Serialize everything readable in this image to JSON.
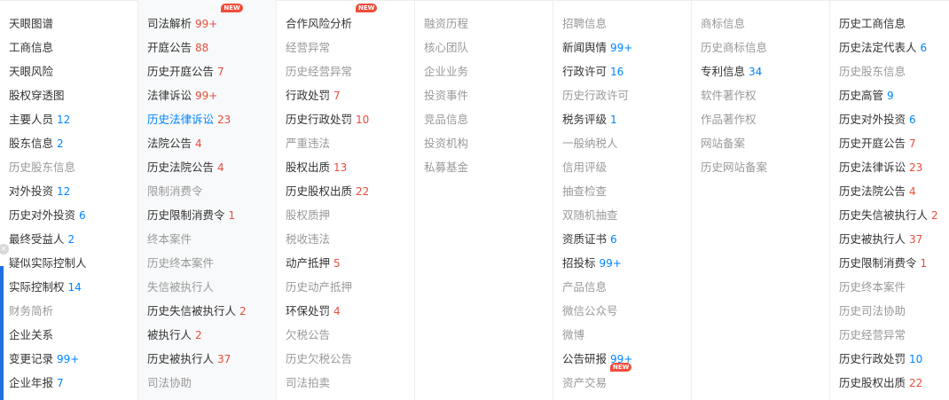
{
  "columns": [
    [
      {
        "label": "天眼图谱",
        "style": "normal"
      },
      {
        "label": "工商信息",
        "style": "normal"
      },
      {
        "label": "天眼风险",
        "style": "normal"
      },
      {
        "label": "股权穿透图",
        "style": "normal"
      },
      {
        "label": "主要人员",
        "style": "normal",
        "count": "12",
        "count_color": "blue"
      },
      {
        "label": "股东信息",
        "style": "normal",
        "count": "2",
        "count_color": "blue"
      },
      {
        "label": "历史股东信息",
        "style": "muted"
      },
      {
        "label": "对外投资",
        "style": "normal",
        "count": "12",
        "count_color": "blue"
      },
      {
        "label": "历史对外投资",
        "style": "normal",
        "count": "6",
        "count_color": "blue"
      },
      {
        "label": "最终受益人",
        "style": "normal",
        "count": "2",
        "count_color": "blue"
      },
      {
        "label": "疑似实际控制人",
        "style": "normal"
      },
      {
        "label": "实际控制权",
        "style": "normal",
        "count": "14",
        "count_color": "blue"
      },
      {
        "label": "财务简析",
        "style": "muted"
      },
      {
        "label": "企业关系",
        "style": "normal"
      },
      {
        "label": "变更记录",
        "style": "normal",
        "count": "99+",
        "count_color": "blue"
      },
      {
        "label": "企业年报",
        "style": "normal",
        "count": "7",
        "count_color": "blue"
      }
    ],
    [
      {
        "label": "司法解析",
        "style": "normal",
        "count": "99+",
        "count_color": "red",
        "badge": "NEW"
      },
      {
        "label": "开庭公告",
        "style": "normal",
        "count": "88",
        "count_color": "red"
      },
      {
        "label": "历史开庭公告",
        "style": "normal",
        "count": "7",
        "count_color": "red"
      },
      {
        "label": "法律诉讼",
        "style": "normal",
        "count": "99+",
        "count_color": "red"
      },
      {
        "label": "历史法律诉讼",
        "style": "link",
        "count": "23",
        "count_color": "red"
      },
      {
        "label": "法院公告",
        "style": "normal",
        "count": "4",
        "count_color": "red"
      },
      {
        "label": "历史法院公告",
        "style": "normal",
        "count": "4",
        "count_color": "red"
      },
      {
        "label": "限制消费令",
        "style": "muted"
      },
      {
        "label": "历史限制消费令",
        "style": "normal",
        "count": "1",
        "count_color": "red"
      },
      {
        "label": "终本案件",
        "style": "muted"
      },
      {
        "label": "历史终本案件",
        "style": "muted"
      },
      {
        "label": "失信被执行人",
        "style": "muted"
      },
      {
        "label": "历史失信被执行人",
        "style": "normal",
        "count": "2",
        "count_color": "red"
      },
      {
        "label": "被执行人",
        "style": "normal",
        "count": "2",
        "count_color": "red"
      },
      {
        "label": "历史被执行人",
        "style": "normal",
        "count": "37",
        "count_color": "red"
      },
      {
        "label": "司法协助",
        "style": "muted"
      }
    ],
    [
      {
        "label": "合作风险分析",
        "style": "normal",
        "badge": "NEW"
      },
      {
        "label": "经营异常",
        "style": "muted"
      },
      {
        "label": "历史经营异常",
        "style": "muted"
      },
      {
        "label": "行政处罚",
        "style": "normal",
        "count": "7",
        "count_color": "red"
      },
      {
        "label": "历史行政处罚",
        "style": "normal",
        "count": "10",
        "count_color": "red"
      },
      {
        "label": "严重违法",
        "style": "muted"
      },
      {
        "label": "股权出质",
        "style": "normal",
        "count": "13",
        "count_color": "red"
      },
      {
        "label": "历史股权出质",
        "style": "normal",
        "count": "22",
        "count_color": "red"
      },
      {
        "label": "股权质押",
        "style": "muted"
      },
      {
        "label": "税收违法",
        "style": "muted"
      },
      {
        "label": "动产抵押",
        "style": "normal",
        "count": "5",
        "count_color": "red"
      },
      {
        "label": "历史动产抵押",
        "style": "muted"
      },
      {
        "label": "环保处罚",
        "style": "normal",
        "count": "4",
        "count_color": "red"
      },
      {
        "label": "欠税公告",
        "style": "muted"
      },
      {
        "label": "历史欠税公告",
        "style": "muted"
      },
      {
        "label": "司法拍卖",
        "style": "muted"
      }
    ],
    [
      {
        "label": "融资历程",
        "style": "muted"
      },
      {
        "label": "核心团队",
        "style": "muted"
      },
      {
        "label": "企业业务",
        "style": "muted"
      },
      {
        "label": "投资事件",
        "style": "muted"
      },
      {
        "label": "竞品信息",
        "style": "muted"
      },
      {
        "label": "投资机构",
        "style": "muted"
      },
      {
        "label": "私募基金",
        "style": "muted"
      }
    ],
    [
      {
        "label": "招聘信息",
        "style": "muted"
      },
      {
        "label": "新闻舆情",
        "style": "normal",
        "count": "99+",
        "count_color": "blue"
      },
      {
        "label": "行政许可",
        "style": "normal",
        "count": "16",
        "count_color": "blue"
      },
      {
        "label": "历史行政许可",
        "style": "muted"
      },
      {
        "label": "税务评级",
        "style": "normal",
        "count": "1",
        "count_color": "blue"
      },
      {
        "label": "一般纳税人",
        "style": "muted"
      },
      {
        "label": "信用评级",
        "style": "muted"
      },
      {
        "label": "抽查检查",
        "style": "muted"
      },
      {
        "label": "双随机抽查",
        "style": "muted"
      },
      {
        "label": "资质证书",
        "style": "normal",
        "count": "6",
        "count_color": "blue"
      },
      {
        "label": "招投标",
        "style": "normal",
        "count": "99+",
        "count_color": "blue"
      },
      {
        "label": "产品信息",
        "style": "muted"
      },
      {
        "label": "微信公众号",
        "style": "muted"
      },
      {
        "label": "微博",
        "style": "muted"
      },
      {
        "label": "公告研报",
        "style": "normal",
        "count": "99+",
        "count_color": "blue"
      },
      {
        "label": "资产交易",
        "style": "muted",
        "badge": "NEW"
      }
    ],
    [
      {
        "label": "商标信息",
        "style": "muted"
      },
      {
        "label": "历史商标信息",
        "style": "muted"
      },
      {
        "label": "专利信息",
        "style": "normal",
        "count": "34",
        "count_color": "blue"
      },
      {
        "label": "软件著作权",
        "style": "muted"
      },
      {
        "label": "作品著作权",
        "style": "muted"
      },
      {
        "label": "网站备案",
        "style": "muted"
      },
      {
        "label": "历史网站备案",
        "style": "muted"
      }
    ],
    [
      {
        "label": "历史工商信息",
        "style": "normal"
      },
      {
        "label": "历史法定代表人",
        "style": "normal",
        "count": "6",
        "count_color": "blue"
      },
      {
        "label": "历史股东信息",
        "style": "muted"
      },
      {
        "label": "历史高管",
        "style": "normal",
        "count": "9",
        "count_color": "blue"
      },
      {
        "label": "历史对外投资",
        "style": "normal",
        "count": "6",
        "count_color": "blue"
      },
      {
        "label": "历史开庭公告",
        "style": "normal",
        "count": "7",
        "count_color": "red"
      },
      {
        "label": "历史法律诉讼",
        "style": "normal",
        "count": "23",
        "count_color": "red"
      },
      {
        "label": "历史法院公告",
        "style": "normal",
        "count": "4",
        "count_color": "red"
      },
      {
        "label": "历史失信被执行人",
        "style": "normal",
        "count": "2",
        "count_color": "red"
      },
      {
        "label": "历史被执行人",
        "style": "normal",
        "count": "37",
        "count_color": "red"
      },
      {
        "label": "历史限制消费令",
        "style": "normal",
        "count": "1",
        "count_color": "red"
      },
      {
        "label": "历史终本案件",
        "style": "muted"
      },
      {
        "label": "历史司法协助",
        "style": "muted"
      },
      {
        "label": "历史经营异常",
        "style": "muted"
      },
      {
        "label": "历史行政处罚",
        "style": "normal",
        "count": "10",
        "count_color": "blue"
      },
      {
        "label": "历史股权出质",
        "style": "normal",
        "count": "22",
        "count_color": "red"
      }
    ]
  ],
  "column_names": [
    "basic-info",
    "judicial-risk",
    "operating-risk",
    "company-development",
    "operating-status",
    "intellectual-property",
    "history-info"
  ],
  "hover_column": 1,
  "colors": {
    "normal": "#333333",
    "muted": "#999999",
    "link": "#0084ff",
    "count_blue": "#0084ff",
    "count_red": "#e84d3d",
    "badge": "#f04d3a"
  },
  "edge": {
    "close_glyph": "×"
  }
}
